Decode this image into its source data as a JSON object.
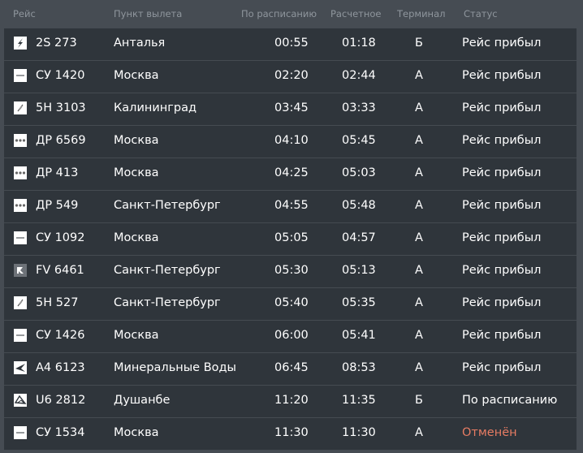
{
  "header": {
    "flight": "Рейс",
    "from": "Пункт вылета",
    "scheduled": "По расписанию",
    "estimated": "Расчетное",
    "terminal": "Терминал",
    "status": "Статус"
  },
  "colors": {
    "row_bg": "#2f353b",
    "page_bg": "#464c53",
    "text": "#ffffff",
    "header_text": "#8f969d",
    "cancelled": "#e77c63"
  },
  "flights": [
    {
      "logo": "s7-airline-icon",
      "flight": "2S 273",
      "from": "Анталья",
      "scheduled": "00:55",
      "estimated": "01:18",
      "terminal": "Б",
      "status": "Рейс прибыл"
    },
    {
      "logo": "aeroflot-airline-icon",
      "flight": "СУ 1420",
      "from": "Москва",
      "scheduled": "02:20",
      "estimated": "02:44",
      "terminal": "A",
      "status": "Рейс прибыл"
    },
    {
      "logo": "pobeda-airline-icon",
      "flight": "5H 3103",
      "from": "Калининград",
      "scheduled": "03:45",
      "estimated": "03:33",
      "terminal": "A",
      "status": "Рейс прибыл"
    },
    {
      "logo": "rossiya-airline-icon",
      "flight": "ДР 6569",
      "from": "Москва",
      "scheduled": "04:10",
      "estimated": "05:45",
      "terminal": "A",
      "status": "Рейс прибыл"
    },
    {
      "logo": "rossiya-airline-icon",
      "flight": "ДР 413",
      "from": "Москва",
      "scheduled": "04:25",
      "estimated": "05:03",
      "terminal": "A",
      "status": "Рейс прибыл"
    },
    {
      "logo": "rossiya-airline-icon",
      "flight": "ДР 549",
      "from": "Санкт-Петербург",
      "scheduled": "04:55",
      "estimated": "05:48",
      "terminal": "A",
      "status": "Рейс прибыл"
    },
    {
      "logo": "aeroflot-airline-icon",
      "flight": "СУ 1092",
      "from": "Москва",
      "scheduled": "05:05",
      "estimated": "04:57",
      "terminal": "A",
      "status": "Рейс прибыл"
    },
    {
      "logo": "nordstar-airline-icon",
      "flight": "FV 6461",
      "from": "Санкт-Петербург",
      "scheduled": "05:30",
      "estimated": "05:13",
      "terminal": "A",
      "status": "Рейс прибыл"
    },
    {
      "logo": "pobeda-airline-icon",
      "flight": "5H 527",
      "from": "Санкт-Петербург",
      "scheduled": "05:40",
      "estimated": "05:35",
      "terminal": "A",
      "status": "Рейс прибыл"
    },
    {
      "logo": "aeroflot-airline-icon",
      "flight": "СУ 1426",
      "from": "Москва",
      "scheduled": "06:00",
      "estimated": "05:41",
      "terminal": "A",
      "status": "Рейс прибыл"
    },
    {
      "logo": "wing-airline-icon",
      "flight": "А4 6123",
      "from": "Минеральные Воды",
      "scheduled": "06:45",
      "estimated": "08:53",
      "terminal": "A",
      "status": "Рейс прибыл"
    },
    {
      "logo": "somon-airline-icon",
      "flight": "U6 2812",
      "from": "Душанбе",
      "scheduled": "11:20",
      "estimated": "11:35",
      "terminal": "Б",
      "status": "По расписанию"
    },
    {
      "logo": "aeroflot-airline-icon",
      "flight": "СУ 1534",
      "from": "Москва",
      "scheduled": "11:30",
      "estimated": "11:30",
      "terminal": "A",
      "status": "Отменён",
      "cancelled": true
    }
  ]
}
